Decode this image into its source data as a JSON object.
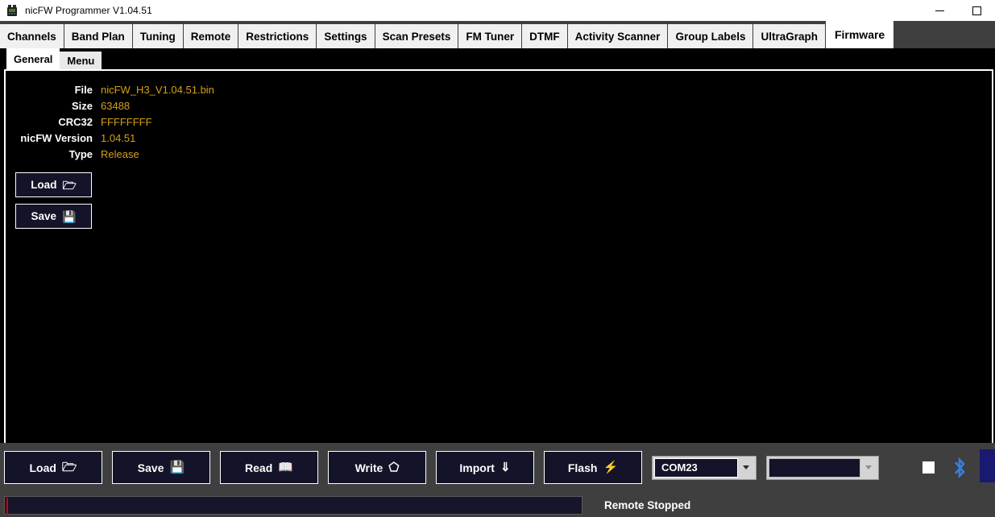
{
  "window": {
    "title": "nicFW Programmer V1.04.51",
    "app_icon": "radio-icon",
    "minimize_label": "Minimize",
    "maximize_label": "Maximize"
  },
  "tabs": [
    {
      "label": "Channels",
      "active": false
    },
    {
      "label": "Band Plan",
      "active": false
    },
    {
      "label": "Tuning",
      "active": false
    },
    {
      "label": "Remote",
      "active": false
    },
    {
      "label": "Restrictions",
      "active": false
    },
    {
      "label": "Settings",
      "active": false
    },
    {
      "label": "Scan Presets",
      "active": false
    },
    {
      "label": "FM Tuner",
      "active": false
    },
    {
      "label": "DTMF",
      "active": false
    },
    {
      "label": "Activity Scanner",
      "active": false
    },
    {
      "label": "Group Labels",
      "active": false
    },
    {
      "label": "UltraGraph",
      "active": false
    },
    {
      "label": "Firmware",
      "active": true
    }
  ],
  "subtabs": [
    {
      "label": "General",
      "active": true
    },
    {
      "label": "Menu",
      "active": false
    }
  ],
  "firmware": {
    "fields": [
      {
        "label": "File",
        "value": "nicFW_H3_V1.04.51.bin"
      },
      {
        "label": "Size",
        "value": "63488"
      },
      {
        "label": "CRC32",
        "value": "FFFFFFFF"
      },
      {
        "label": "nicFW Version",
        "value": "1.04.51"
      },
      {
        "label": "Type",
        "value": "Release"
      }
    ],
    "buttons": [
      {
        "label": "Load",
        "icon": "folder-icon",
        "glyph": "🗁"
      },
      {
        "label": "Save",
        "icon": "floppy-disk-icon",
        "glyph": "💾"
      }
    ]
  },
  "toolbar": {
    "buttons": [
      {
        "label": "Load",
        "icon": "folder-icon",
        "glyph": "🗁"
      },
      {
        "label": "Save",
        "icon": "floppy-disk-icon",
        "glyph": "💾"
      },
      {
        "label": "Read",
        "icon": "book-icon",
        "glyph": "📖"
      },
      {
        "label": "Write",
        "icon": "pen-nib-icon",
        "glyph": "⬠"
      },
      {
        "label": "Import",
        "icon": "down-arrow-icon",
        "glyph": "⇓"
      },
      {
        "label": "Flash",
        "icon": "lightning-bolt-icon",
        "glyph": "⚡"
      }
    ],
    "port_combo": {
      "value": "COM23",
      "placeholder": "COM port"
    },
    "secondary_combo": {
      "value": "",
      "placeholder": ""
    },
    "checkbox": {
      "label": "enable-toggle",
      "checked": false
    },
    "bluetooth_icon": "bluetooth-icon",
    "accent_button_color": "#191970"
  },
  "statusbar": {
    "progress_percent": 0,
    "status_text": "Remote Stopped"
  },
  "colors": {
    "value_gold": "#d4a017",
    "panel_black": "#000000",
    "chrome_gray": "#3f3f3f",
    "button_navy": "#131329",
    "bluetooth_blue": "#3b7ddd"
  }
}
